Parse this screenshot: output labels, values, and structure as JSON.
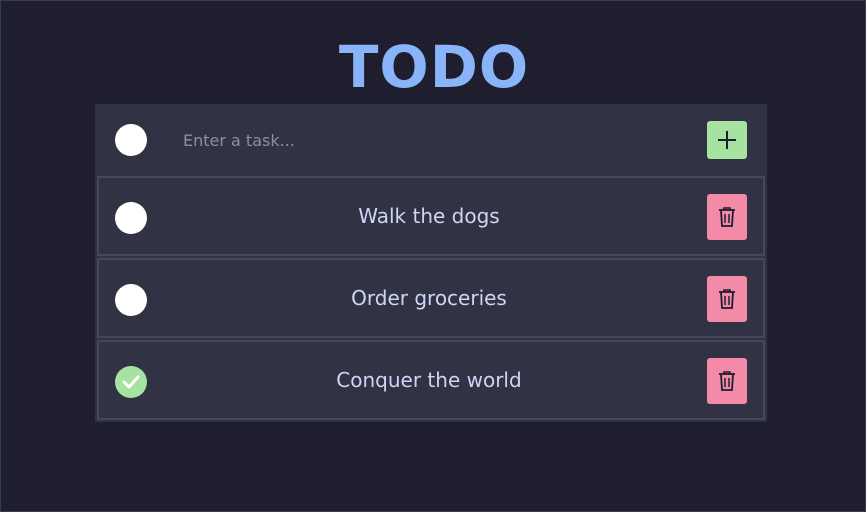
{
  "app": {
    "title": "TODO",
    "colors": {
      "background": "#1e1e2e",
      "panel": "#313244",
      "border": "#45475a",
      "title": "#89b4fa",
      "add_button": "#a6e3a1",
      "delete_button": "#f38ba8",
      "done_check": "#a6e3a1"
    }
  },
  "new_task": {
    "placeholder": "Enter a task...",
    "value": "",
    "add_icon": "plus-icon"
  },
  "tasks": [
    {
      "label": "Walk the dogs",
      "completed": false,
      "delete_icon": "trash-icon"
    },
    {
      "label": "Order groceries",
      "completed": false,
      "delete_icon": "trash-icon"
    },
    {
      "label": "Conquer the world",
      "completed": true,
      "delete_icon": "trash-icon"
    }
  ]
}
